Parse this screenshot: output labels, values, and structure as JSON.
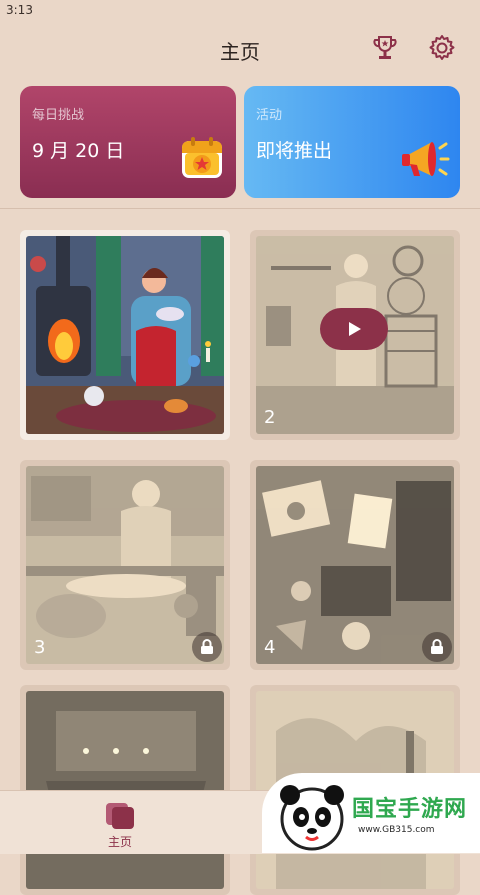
{
  "status": {
    "time": "3:13"
  },
  "header": {
    "title": "主页"
  },
  "daily_card": {
    "label": "每日挑战",
    "date": "9 月 20 日"
  },
  "event_card": {
    "label": "活动",
    "status": "即将推出"
  },
  "tiles": [
    {
      "number": "",
      "locked": false
    },
    {
      "number": "2",
      "locked": false
    },
    {
      "number": "3",
      "locked": true
    },
    {
      "number": "4",
      "locked": true
    },
    {
      "number": "",
      "locked": false
    },
    {
      "number": "",
      "locked": false
    }
  ],
  "bottom_nav": {
    "home_label": "主页"
  },
  "watermark": {
    "brand": "国宝手游网",
    "url": "www.GB315.com"
  },
  "colors": {
    "accent": "#8c3149",
    "background": "#ead7c8"
  }
}
